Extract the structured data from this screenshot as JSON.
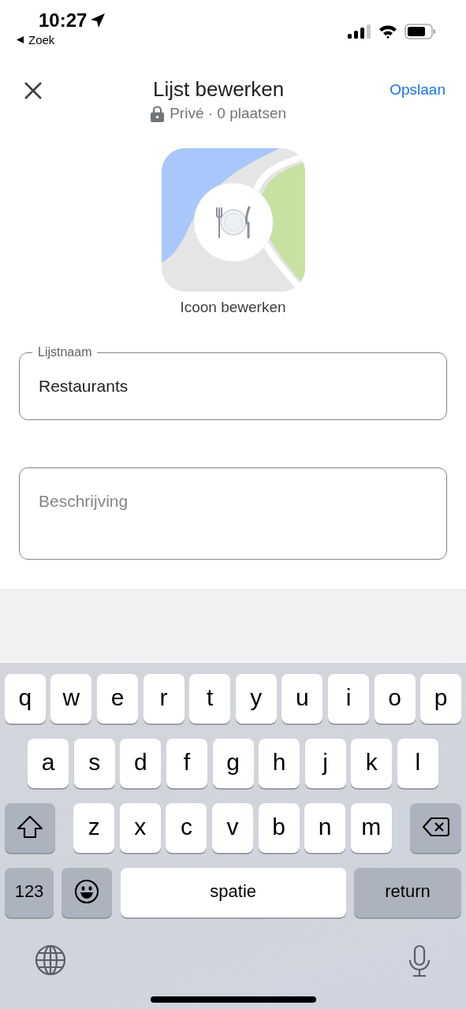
{
  "status_bar": {
    "time": "10:27",
    "back_label": "Zoek"
  },
  "header": {
    "title": "Lijst bewerken",
    "subtitle": "Privé · 0 plaatsen",
    "save": "Opslaan"
  },
  "list_icon": {
    "label": "Icoon bewerken"
  },
  "fields": [
    {
      "kind": "filled",
      "label": "Lijstnaam",
      "value": "Restaurants"
    },
    {
      "kind": "empty",
      "placeholder": "Beschrijving"
    }
  ],
  "keyboard": {
    "rows": [
      {
        "keys": [
          {
            "kind": "letter",
            "label": "q"
          },
          {
            "kind": "letter",
            "label": "w"
          },
          {
            "kind": "letter",
            "label": "e"
          },
          {
            "kind": "letter",
            "label": "r"
          },
          {
            "kind": "letter",
            "label": "t"
          },
          {
            "kind": "letter",
            "label": "y"
          },
          {
            "kind": "letter",
            "label": "u"
          },
          {
            "kind": "letter",
            "label": "i"
          },
          {
            "kind": "letter",
            "label": "o"
          },
          {
            "kind": "letter",
            "label": "p"
          }
        ]
      },
      {
        "keys": [
          {
            "kind": "letter",
            "label": "a"
          },
          {
            "kind": "letter",
            "label": "s"
          },
          {
            "kind": "letter",
            "label": "d"
          },
          {
            "kind": "letter",
            "label": "f"
          },
          {
            "kind": "letter",
            "label": "g"
          },
          {
            "kind": "letter",
            "label": "h"
          },
          {
            "kind": "letter",
            "label": "j"
          },
          {
            "kind": "letter",
            "label": "k"
          },
          {
            "kind": "letter",
            "label": "l"
          }
        ]
      },
      {
        "keys": [
          {
            "kind": "shift"
          },
          {
            "kind": "letter",
            "label": "z"
          },
          {
            "kind": "letter",
            "label": "x"
          },
          {
            "kind": "letter",
            "label": "c"
          },
          {
            "kind": "letter",
            "label": "v"
          },
          {
            "kind": "letter",
            "label": "b"
          },
          {
            "kind": "letter",
            "label": "n"
          },
          {
            "kind": "letter",
            "label": "m"
          },
          {
            "kind": "delete"
          }
        ]
      },
      {
        "keys": [
          {
            "kind": "numbers",
            "label": "123"
          },
          {
            "kind": "emoji"
          },
          {
            "kind": "space",
            "label": "spatie"
          },
          {
            "kind": "return",
            "label": "return"
          }
        ]
      }
    ]
  }
}
